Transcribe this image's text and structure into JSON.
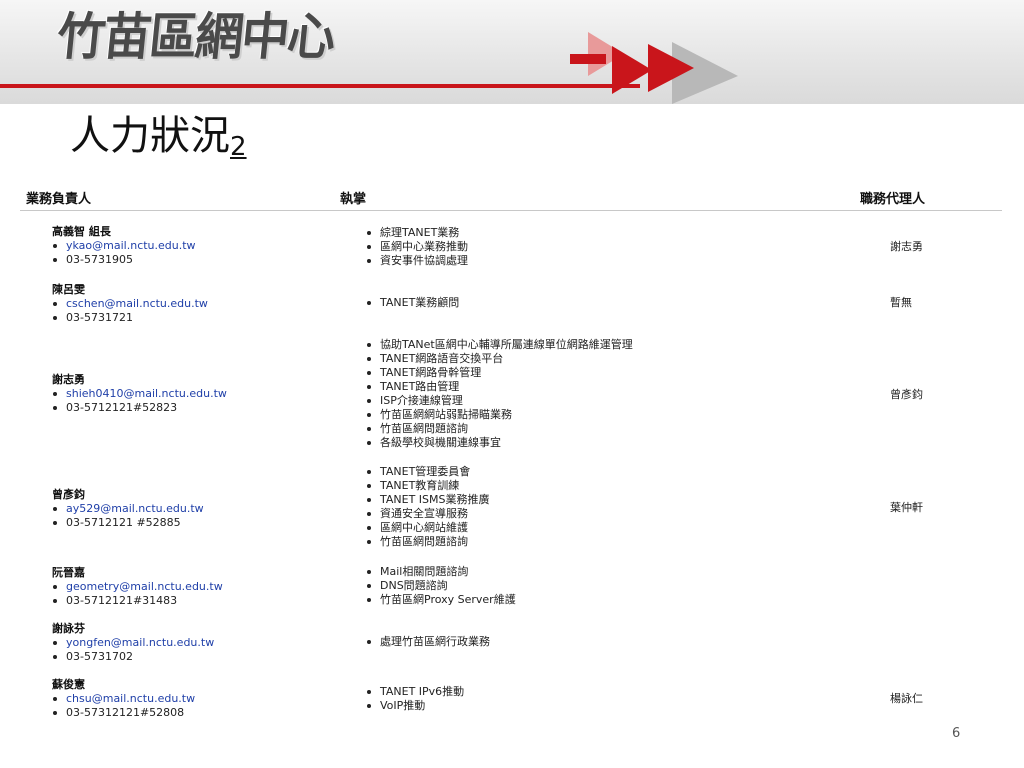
{
  "header": {
    "logo_text": "竹苗區網中心",
    "colors": {
      "red": "#c9151b",
      "gray": "#8a8a8a",
      "lightgray": "#c8c8c8"
    }
  },
  "slide": {
    "title": "人力狀況",
    "title_sub": "2",
    "page_number": "6"
  },
  "table": {
    "headers": {
      "person": "業務負責人",
      "duties": "執掌",
      "deputy": "職務代理人"
    },
    "rows": [
      {
        "name": "高義智 組長",
        "email": "ykao@mail.nctu.edu.tw",
        "phone": "03-5731905",
        "duties": [
          "綜理TANET業務",
          "區網中心業務推動",
          "資安事件協調處理"
        ],
        "deputy": "謝志勇"
      },
      {
        "name": "陳呂雯",
        "email": "cschen@mail.nctu.edu.tw",
        "phone": "03-5731721",
        "duties": [
          "TANET業務顧問"
        ],
        "deputy": "暫無"
      },
      {
        "name": "謝志勇",
        "email": "shieh0410@mail.nctu.edu.tw",
        "phone": "03-5712121#52823",
        "duties": [
          "協助TANet區網中心輔導所屬連線單位網路維運管理",
          "TANET網路語音交換平台",
          "TANET網路骨幹管理",
          "TANET路由管理",
          "ISP介接連線管理",
          "竹苗區網網站弱點掃瞄業務",
          "竹苗區網問題諮詢",
          "各級學校與機關連線事宜"
        ],
        "deputy": "曾彥鈞"
      },
      {
        "name": "曾彥鈞",
        "email": "ay529@mail.nctu.edu.tw",
        "phone": "03-5712121 #52885",
        "duties": [
          "TANET管理委員會",
          "TANET教育訓練",
          "TANET ISMS業務推廣",
          "資通安全宣導服務",
          "區網中心網站維護",
          "竹苗區網問題諮詢"
        ],
        "deputy": "葉仲軒"
      },
      {
        "name": "阮晉嘉",
        "email": "geometry@mail.nctu.edu.tw",
        "phone": "03-5712121#31483",
        "duties": [
          "Mail相關問題諮詢",
          "DNS問題諮詢",
          "竹苗區網Proxy Server維護"
        ],
        "deputy": ""
      },
      {
        "name": "謝詠芬",
        "email": "yongfen@mail.nctu.edu.tw",
        "phone": "03-5731702",
        "duties": [
          "處理竹苗區網行政業務"
        ],
        "deputy": ""
      },
      {
        "name": "蘇俊憲",
        "email": "chsu@mail.nctu.edu.tw",
        "phone": "03-57312121#52808",
        "duties": [
          "TANET IPv6推動",
          "VoIP推動"
        ],
        "deputy": "楊詠仁"
      }
    ]
  }
}
